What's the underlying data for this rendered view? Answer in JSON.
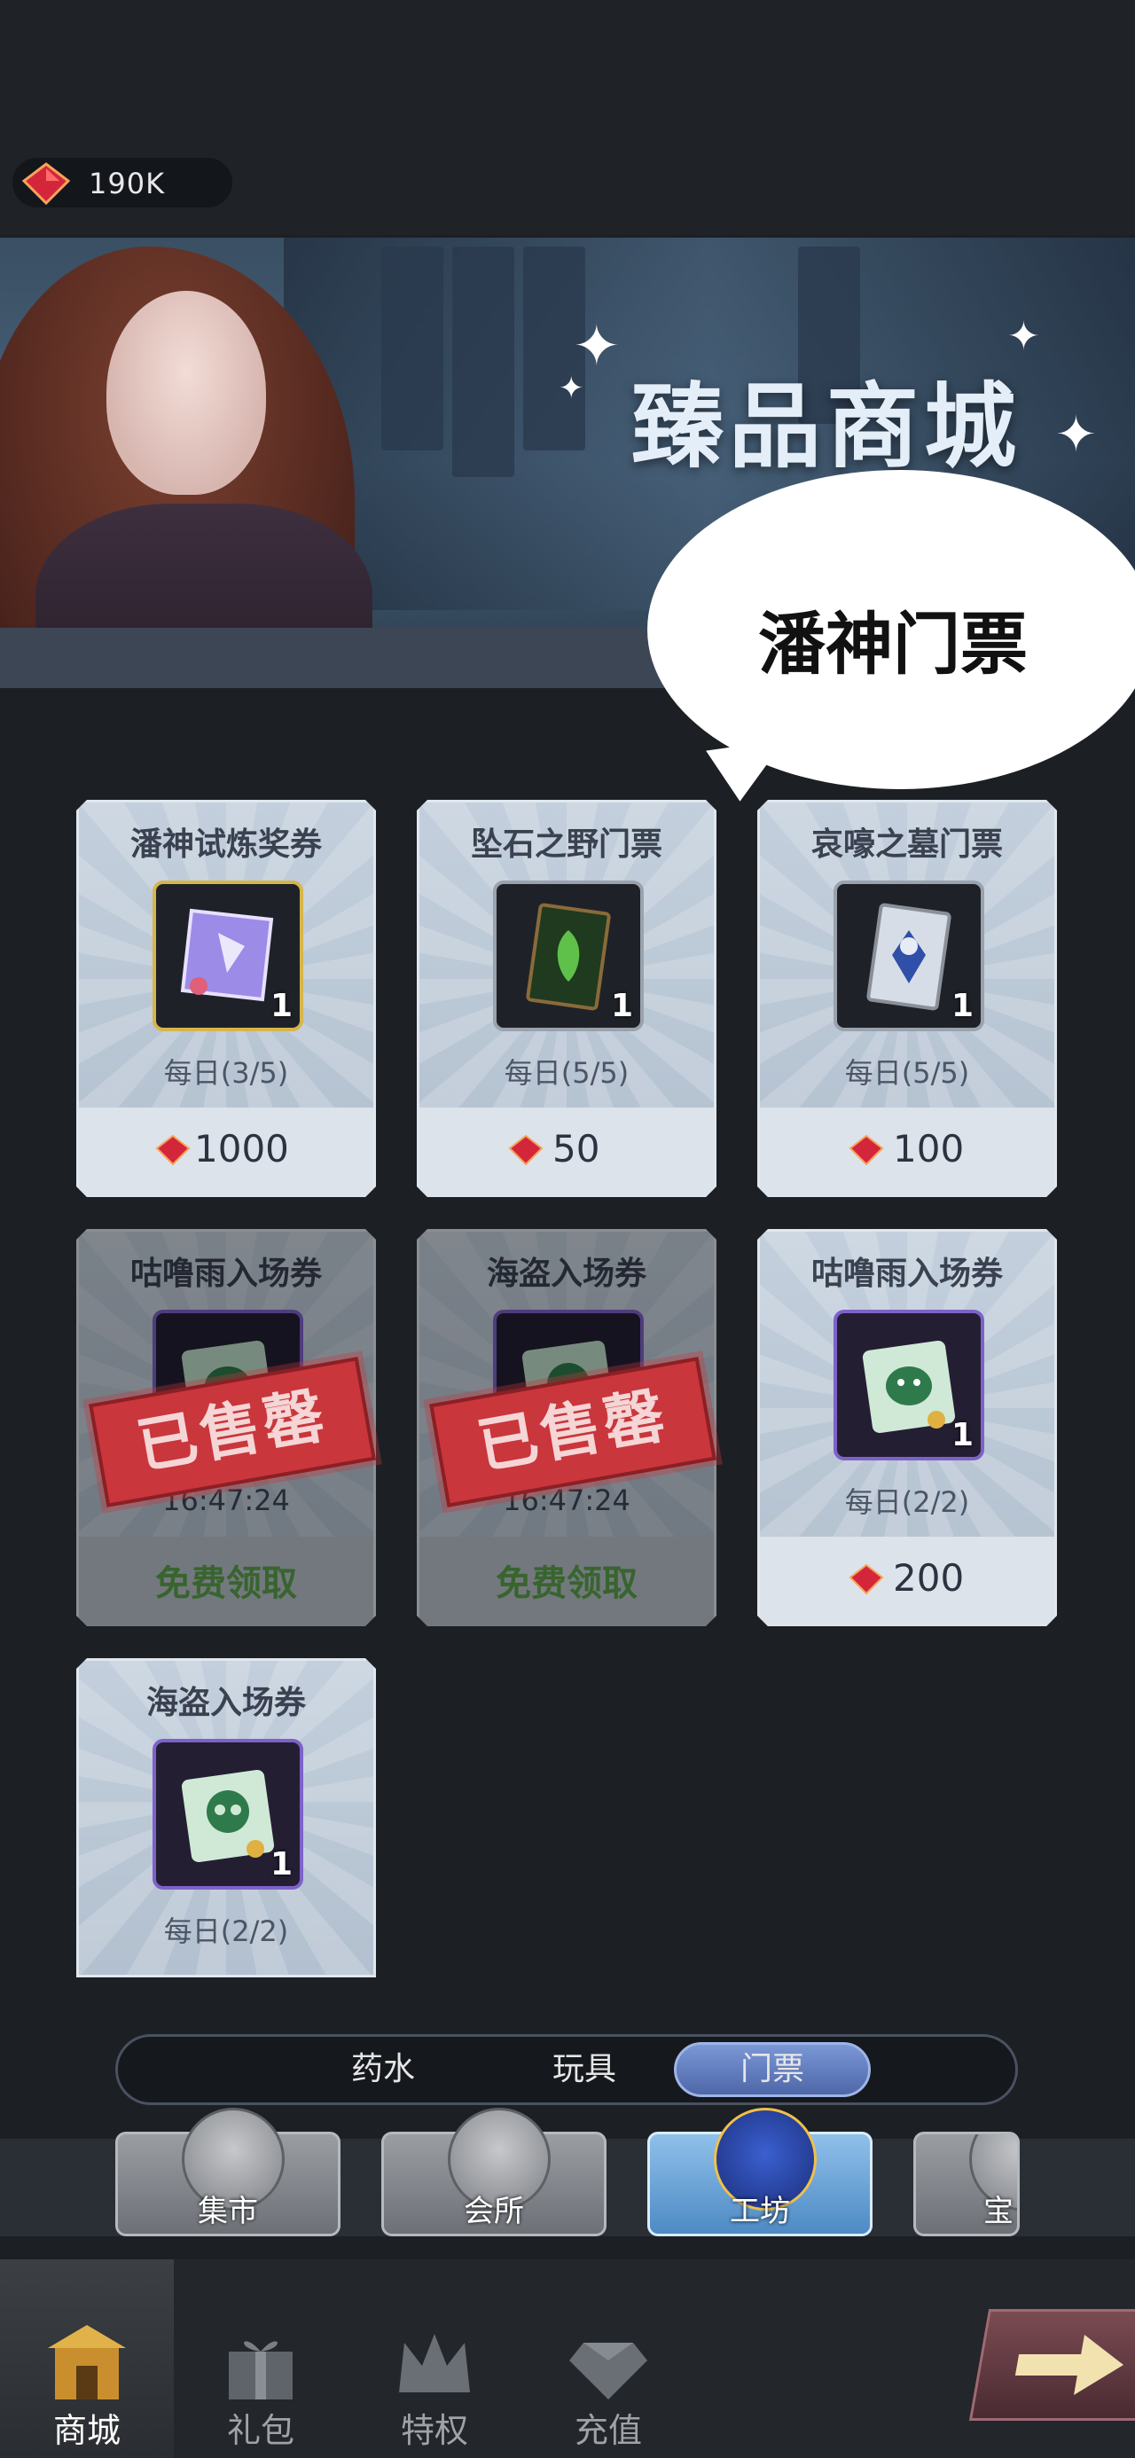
{
  "currency": {
    "amount": "190K",
    "icon": "red-gem-icon"
  },
  "banner": {
    "title": "臻品商城",
    "bubble_text": "潘神门票"
  },
  "cards": [
    {
      "name": "潘神试炼奖券",
      "qty": "1",
      "limit": "每日(3/5)",
      "price": "1000",
      "icon": "ticket-icon",
      "frame": "gold"
    },
    {
      "name": "坠石之野门票",
      "qty": "1",
      "limit": "每日(5/5)",
      "price": "50",
      "icon": "green-card-icon",
      "frame": "silver"
    },
    {
      "name": "哀嚎之墓门票",
      "qty": "1",
      "limit": "每日(5/5)",
      "price": "100",
      "icon": "blue-card-icon",
      "frame": "silver"
    },
    {
      "name": "咕噜雨入场券",
      "sold_out": "已售罄",
      "timer": "16:47:24",
      "free": "免费领取"
    },
    {
      "name": "海盗入场券",
      "sold_out": "已售罄",
      "timer": "16:47:24",
      "free": "免费领取"
    },
    {
      "name": "咕噜雨入场券",
      "qty": "1",
      "limit": "每日(2/2)",
      "price": "200",
      "icon": "slime-pass-icon",
      "frame": "purple"
    },
    {
      "name": "海盗入场券",
      "qty": "1",
      "limit": "每日(2/2)",
      "icon": "skull-pass-icon",
      "frame": "purple"
    }
  ],
  "tabs": {
    "items": [
      "药水",
      "玩具",
      "门票"
    ],
    "active": "门票"
  },
  "subnav": {
    "items": [
      "集市",
      "会所",
      "工坊",
      "宝"
    ],
    "active": "工坊"
  },
  "bottomnav": {
    "items": [
      "商城",
      "礼包",
      "特权",
      "充值"
    ],
    "active": "商城"
  }
}
